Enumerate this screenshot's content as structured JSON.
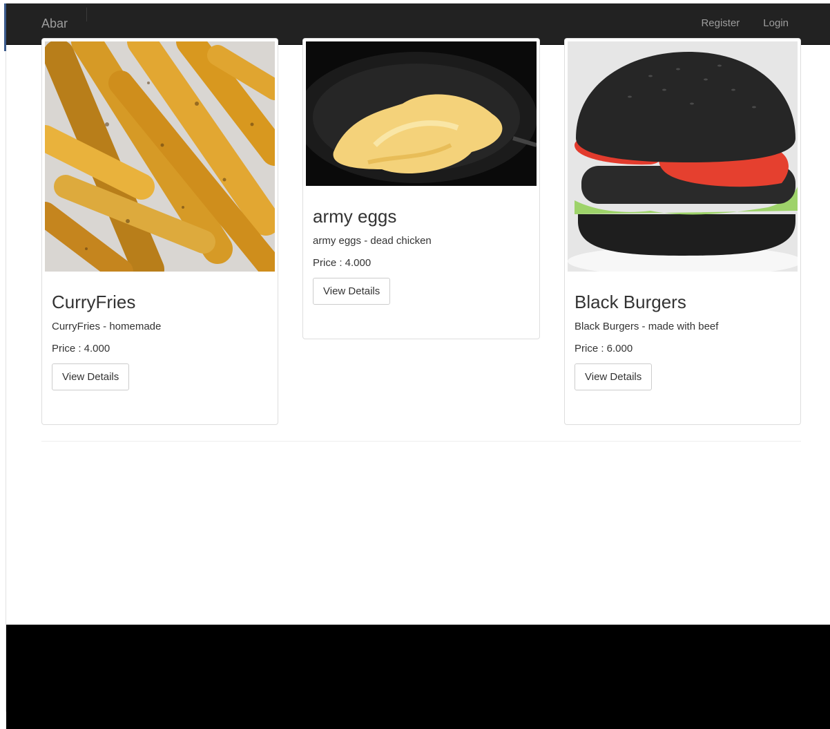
{
  "navbar": {
    "brand": "Abar",
    "links": [
      "Register",
      "Login"
    ]
  },
  "products": [
    {
      "name": "CurryFries",
      "description": "CurryFries - homemade",
      "price": "Price : 4.000",
      "button": "View Details"
    },
    {
      "name": "army eggs",
      "description": "army eggs - dead chicken",
      "price": "Price : 4.000",
      "button": "View Details"
    },
    {
      "name": "Black Burgers",
      "description": "Black Burgers - made with beef",
      "price": "Price : 6.000",
      "button": "View Details"
    }
  ],
  "colors": {
    "navbar_bg": "#222222",
    "nav_text": "#9d9d9d",
    "footer_bg": "#000000",
    "card_border": "#dddddd"
  }
}
